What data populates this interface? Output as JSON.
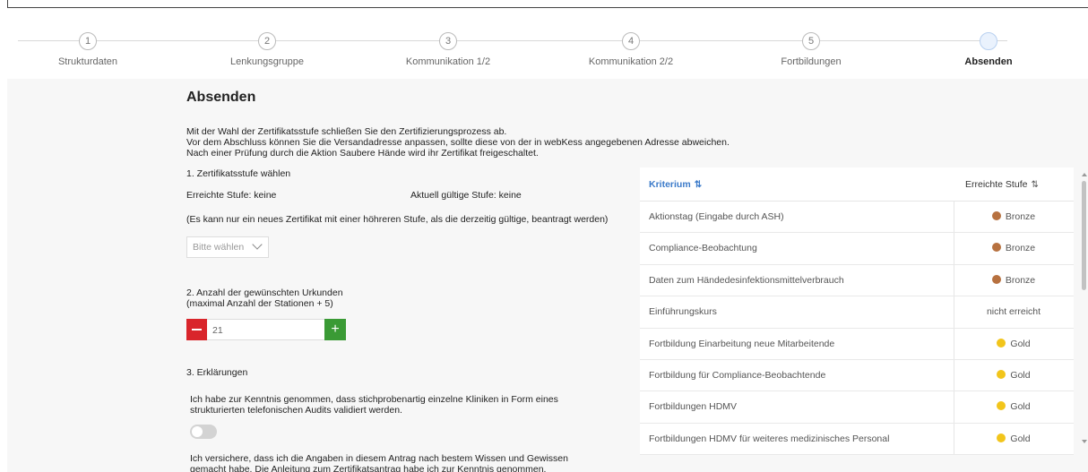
{
  "steps": [
    {
      "num": "1",
      "label": "Strukturdaten"
    },
    {
      "num": "2",
      "label": "Lenkungsgruppe"
    },
    {
      "num": "3",
      "label": "Kommunikation 1/2"
    },
    {
      "num": "4",
      "label": "Kommunikation 2/2"
    },
    {
      "num": "5",
      "label": "Fortbildungen"
    },
    {
      "num": "",
      "label": "Absenden"
    }
  ],
  "page": {
    "title": "Absenden",
    "intro": [
      "Mit der Wahl der Zertifikatsstufe schließen Sie den Zertifizierungsprozess ab.",
      "Vor dem Abschluss können Sie die Versandadresse anpassen, sollte diese von der in webKess angegebenen Adresse abweichen.",
      "Nach einer Prüfung durch die Aktion Saubere Hände wird ihr Zertifikat freigeschaltet."
    ]
  },
  "section1": {
    "label": "1. Zertifikatsstufe wählen",
    "reached": "Erreichte Stufe: keine",
    "current": "Aktuell gültige Stufe: keine",
    "note": "(Es kann nur ein neues Zertifikat mit einer höhreren Stufe, als die derzeitig gültige, beantragt werden)",
    "select_placeholder": "Bitte wählen"
  },
  "section2": {
    "label_line1": "2. Anzahl der gewünschten Urkunden",
    "label_line2": "(maximal Anzahl der Stationen + 5)",
    "value": "21",
    "plus": "+"
  },
  "section3": {
    "label": "3. Erklärungen",
    "statement1_line1": "Ich habe zur Kenntnis genommen, dass stichprobenartig einzelne Kliniken in Form eines",
    "statement1_line2": "strukturierten telefonischen Audits validiert werden.",
    "statement2_line1": "Ich versichere, dass ich die Angaben in diesem Antrag nach bestem Wissen und Gewissen",
    "statement2_line2": "gemacht habe. Die Anleitung zum Zertifikatsantrag habe ich zur Kenntnis genommen."
  },
  "table": {
    "col_criterion": "Kriterium",
    "col_level": "Erreichte Stufe",
    "rows": [
      {
        "criterion": "Aktionstag (Eingabe durch ASH)",
        "level": "Bronze",
        "color": "#b7713f"
      },
      {
        "criterion": "Compliance-Beobachtung",
        "level": "Bronze",
        "color": "#b7713f"
      },
      {
        "criterion": "Daten zum Händedesinfektionsmittelverbrauch",
        "level": "Bronze",
        "color": "#b7713f"
      },
      {
        "criterion": "Einführungskurs",
        "level": "nicht erreicht",
        "color": ""
      },
      {
        "criterion": "Fortbildung Einarbeitung neue Mitarbeitende",
        "level": "Gold",
        "color": "#f2c51b"
      },
      {
        "criterion": "Fortbildung für Compliance-Beobachtende",
        "level": "Gold",
        "color": "#f2c51b"
      },
      {
        "criterion": "Fortbildungen HDMV",
        "level": "Gold",
        "color": "#f2c51b"
      },
      {
        "criterion": "Fortbildungen HDMV für weiteres medizinisches Personal",
        "level": "Gold",
        "color": "#f2c51b"
      }
    ]
  },
  "colors": {
    "accent": "#3b7ac9",
    "minus": "#d9252b",
    "plus": "#3a9a35"
  }
}
